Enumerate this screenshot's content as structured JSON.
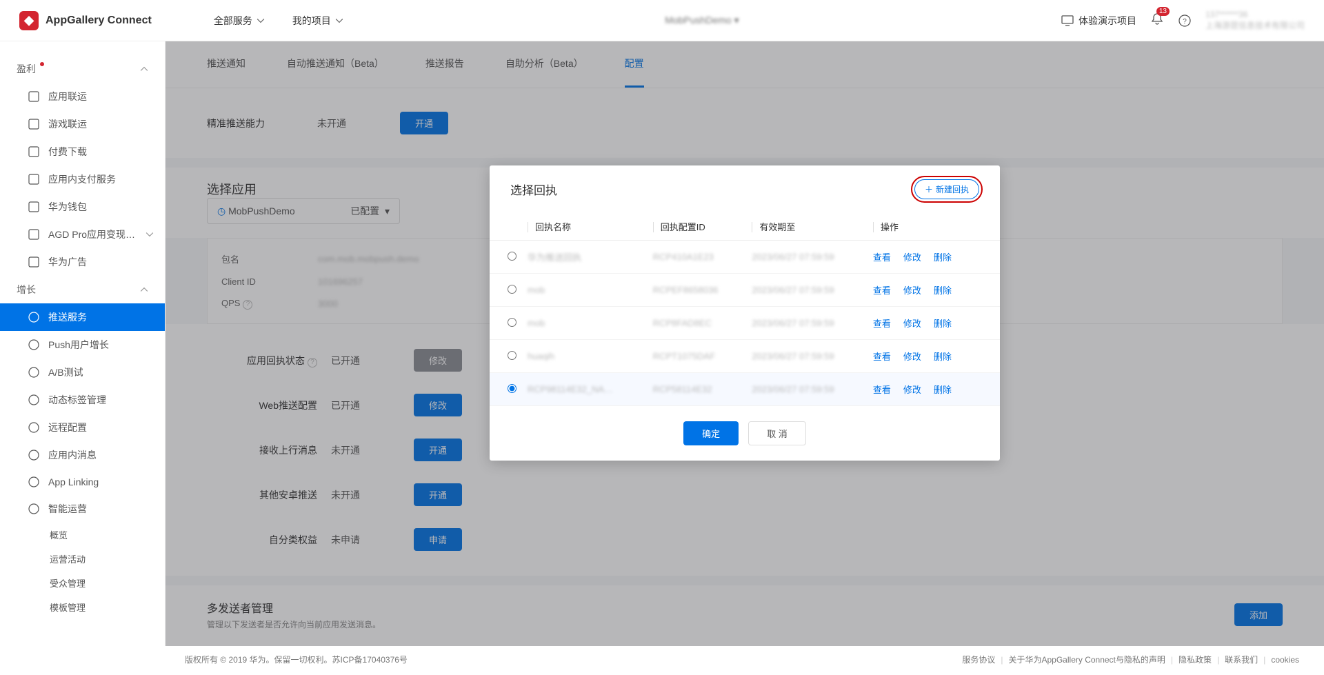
{
  "brand": "AppGallery Connect",
  "header": {
    "menu1": "全部服务",
    "menu2": "我的项目",
    "project": "MobPushDemo",
    "demo": "体验演示项目",
    "badge": "13",
    "acct_line1": "137******36",
    "acct_line2": "上海游昆信息技术有限公司"
  },
  "sidebar": {
    "group_profit": "盈利",
    "group_growth": "增长",
    "items_profit": [
      "应用联运",
      "游戏联运",
      "付费下载",
      "应用内支付服务",
      "华为钱包",
      "AGD Pro应用变现…",
      "华为广告"
    ],
    "items_growth": [
      "推送服务",
      "Push用户增长",
      "A/B测试",
      "动态标签管理",
      "远程配置",
      "应用内消息",
      "App Linking",
      "智能运营"
    ],
    "sub_smart": [
      "概览",
      "运营活动",
      "受众管理",
      "模板管理"
    ]
  },
  "tabs": [
    "推送通知",
    "自动推送通知（Beta）",
    "推送报告",
    "自助分析（Beta）",
    "配置"
  ],
  "precise": {
    "label": "精准推送能力",
    "status": "未开通",
    "btn": "开通"
  },
  "select_app": {
    "title": "选择应用",
    "name": "MobPushDemo",
    "status": "已配置"
  },
  "info": {
    "pkg_k": "包名",
    "pkg_v": "com.mob.mobpush.demo",
    "cid_k": "Client ID",
    "cid_v": "101696257",
    "qps_k": "QPS",
    "qps_v": "3000"
  },
  "form": {
    "r1": {
      "label": "应用回执状态",
      "val": "已开通",
      "btn": "修改"
    },
    "r2": {
      "label": "Web推送配置",
      "val": "已开通",
      "btn": "修改"
    },
    "r3": {
      "label": "接收上行消息",
      "val": "未开通",
      "btn": "开通"
    },
    "r4": {
      "label": "其他安卓推送",
      "val": "未开通",
      "btn": "开通"
    },
    "r5": {
      "label": "自分类权益",
      "val": "未申请",
      "btn": "申请"
    }
  },
  "multisender": {
    "title": "多发送者管理",
    "sub": "管理以下发送者是否允许向当前应用发送消息。",
    "btn": "添加"
  },
  "modal": {
    "title": "选择回执",
    "new": "新建回执",
    "th": [
      "",
      "回执名称",
      "回执配置ID",
      "有效期至",
      "操作"
    ],
    "rows": [
      {
        "name": "华为推送回执",
        "cfg": "RCP410A1E23",
        "exp": "2023/06/27 07:59:59"
      },
      {
        "name": "mob",
        "cfg": "RCPEF8658036",
        "exp": "2023/06/27 07:59:59"
      },
      {
        "name": "mob",
        "cfg": "RCP8FAD8EC",
        "exp": "2023/06/27 07:59:59"
      },
      {
        "name": "huaqih",
        "cfg": "RCPT1075DAF",
        "exp": "2023/06/27 07:59:59"
      },
      {
        "name": "RCP98114E32_NA…",
        "cfg": "RCP58114E32",
        "exp": "2023/06/27 07:59:59"
      }
    ],
    "act_view": "查看",
    "act_edit": "修改",
    "act_del": "删除",
    "ok": "确定",
    "cancel": "取 消"
  },
  "footer": {
    "left": "版权所有 © 2019 华为。保留一切权利。苏ICP备17040376号",
    "links": [
      "服务协议",
      "关于华为AppGallery Connect与隐私的声明",
      "隐私政策",
      "联系我们",
      "cookies"
    ]
  }
}
